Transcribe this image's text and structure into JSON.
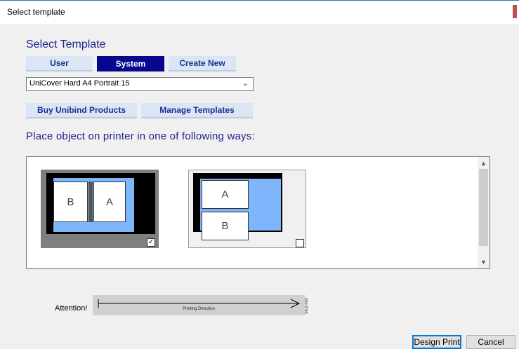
{
  "window": {
    "title": "Select template"
  },
  "heading": "Select Template",
  "tabs": {
    "user": "User",
    "system": "System",
    "create_new": "Create New"
  },
  "template_select": {
    "value": "UniCover Hard A4 Portrait 15"
  },
  "buttons": {
    "buy": "Buy Unibind Products",
    "manage": "Manage Templates",
    "design_print": "Design Print",
    "cancel": "Cancel"
  },
  "instruction": "Place object on printer in one of following ways:",
  "options": [
    {
      "pages": [
        "B",
        "A"
      ],
      "checked": true,
      "checkmark": "✓"
    },
    {
      "pages": [
        "A",
        "B"
      ],
      "checked": false,
      "checkmark": ""
    }
  ],
  "attention": {
    "label": "Attention!",
    "direction_label": "Printing Direction",
    "size": "56,9 mm"
  },
  "colors": {
    "heading": "#1f1f8f",
    "tab_active": "#06068e",
    "tab_inactive": "#dbe6f5",
    "tray_blue": "#7fb5fb"
  }
}
